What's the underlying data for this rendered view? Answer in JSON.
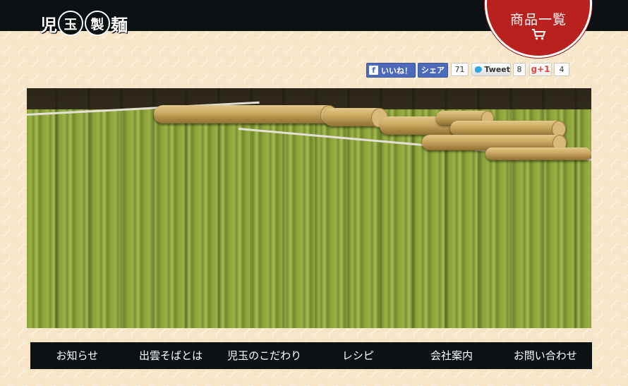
{
  "brand": {
    "logo_chars": [
      "児",
      "玉",
      "製",
      "麺"
    ]
  },
  "header": {
    "products_label": "商品一覧",
    "cart_icon": "cart-icon"
  },
  "social": {
    "facebook_like_label": "いいね！",
    "facebook_share_label": "シェア",
    "facebook_count": "71",
    "tweet_label": "Tweet",
    "tweet_count": "8",
    "gplus_label": "g+1",
    "gplus_count": "4"
  },
  "slider": {
    "image": "green-noodles-drying-on-bamboo-rods",
    "slide_count": 5,
    "active_index": 3
  },
  "nav": {
    "items": [
      "お知らせ",
      "出雲そばとは",
      "児玉のこだわり",
      "レシピ",
      "会社案内",
      "お問い合わせ"
    ]
  },
  "colors": {
    "topbar": "#0c1114",
    "accent_red": "#b8211d",
    "background": "#f6e5c6"
  }
}
